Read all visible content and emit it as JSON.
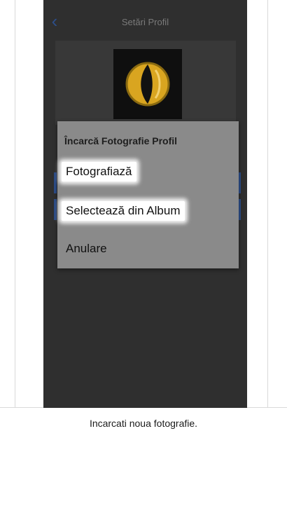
{
  "header": {
    "title": "Setări Profil",
    "back_icon": "chevron-left-icon"
  },
  "dialog": {
    "title": "Încarcă Fotografie Profil",
    "options": [
      {
        "label": "Fotografiază",
        "highlighted": true
      },
      {
        "label": "Selectează din Album",
        "highlighted": true
      },
      {
        "label": "Anulare",
        "highlighted": false
      }
    ]
  },
  "caption": "Incarcati noua fotografie.",
  "colors": {
    "accent": "#2c4e8a",
    "screen_bg": "#2f2f2f",
    "dialog_bg": "#8a8a8a",
    "avatar_gold": "#d9a520"
  }
}
